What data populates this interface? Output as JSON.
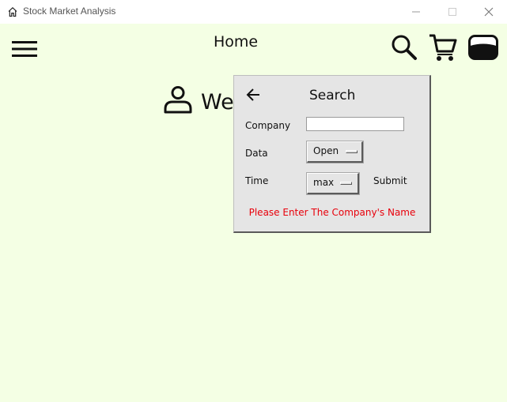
{
  "window": {
    "title": "Stock Market Analysis",
    "icon": "home-outline-icon",
    "controls": [
      "minimize-icon",
      "maximize-icon",
      "close-icon"
    ]
  },
  "header": {
    "title": "Home",
    "icons": [
      "hamburger-menu-icon",
      "search-icon",
      "shopping-cart-icon",
      "wallet-icon"
    ]
  },
  "welcome": {
    "icon": "user-icon",
    "text": "We"
  },
  "search_panel": {
    "back_icon": "arrow-left-icon",
    "title": "Search",
    "company_label": "Company",
    "company_value": "",
    "data_label": "Data",
    "data_selected": "Open",
    "time_label": "Time",
    "time_selected": "max",
    "submit_label": "Submit",
    "error_message": "Please Enter The Company's Name"
  },
  "colors": {
    "background": "#f4ffe4",
    "panel": "#e5e5e5",
    "error": "#e8000b"
  }
}
